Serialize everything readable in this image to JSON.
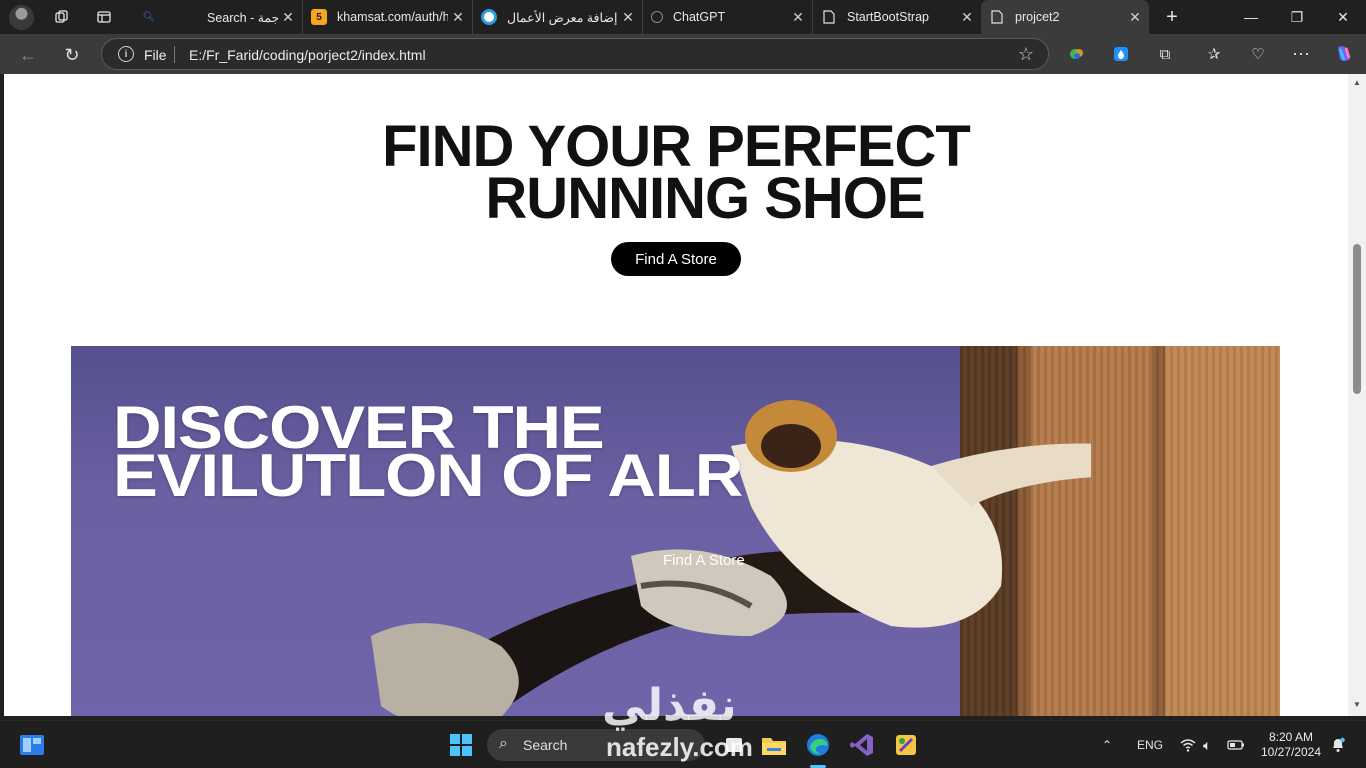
{
  "browser": {
    "tabs": [
      {
        "title": "Search - ترجمة",
        "favicon": "search-favicon",
        "active": false
      },
      {
        "title": "khamsat.com/auth/h",
        "favicon": "khamsat-favicon",
        "active": false
      },
      {
        "title": "إضافة معرض الأعمال",
        "favicon": "circle-favicon",
        "active": false
      },
      {
        "title": "ChatGPT",
        "favicon": "chatgpt-favicon",
        "active": false
      },
      {
        "title": "StartBootStrap",
        "favicon": "page-favicon",
        "active": false
      },
      {
        "title": "projcet2",
        "favicon": "page-favicon",
        "active": true
      }
    ],
    "new_tab_glyph": "+",
    "window_controls": {
      "minimize": "—",
      "restore": "❐",
      "close": "✕"
    },
    "address": {
      "scheme_label": "File",
      "url": "E:/Fr_Farid/coding/porject2/index.html"
    }
  },
  "page": {
    "hero": {
      "title_line1": "FIND YOUR PERFECT",
      "title_line2": "RUNNING SHOE",
      "button_label": "Find A Store"
    },
    "banner": {
      "title_line1": "DISCOVER THE",
      "title_line2": "EVILUTLON OF ALR",
      "link_label": "Find A Store"
    }
  },
  "watermark": {
    "arabic": "نفذلي",
    "latin": "nafezly.com"
  },
  "taskbar": {
    "search_label": "Search",
    "language": "ENG",
    "time": "8:20 AM",
    "date": "10/27/2024"
  },
  "colors": {
    "tabstrip_bg": "#202020",
    "toolbar_bg": "#3b3b3b",
    "hero_button_bg": "#000000",
    "banner_sky": "#6b60a2",
    "taskbar_accent": "#4cc2ff"
  }
}
